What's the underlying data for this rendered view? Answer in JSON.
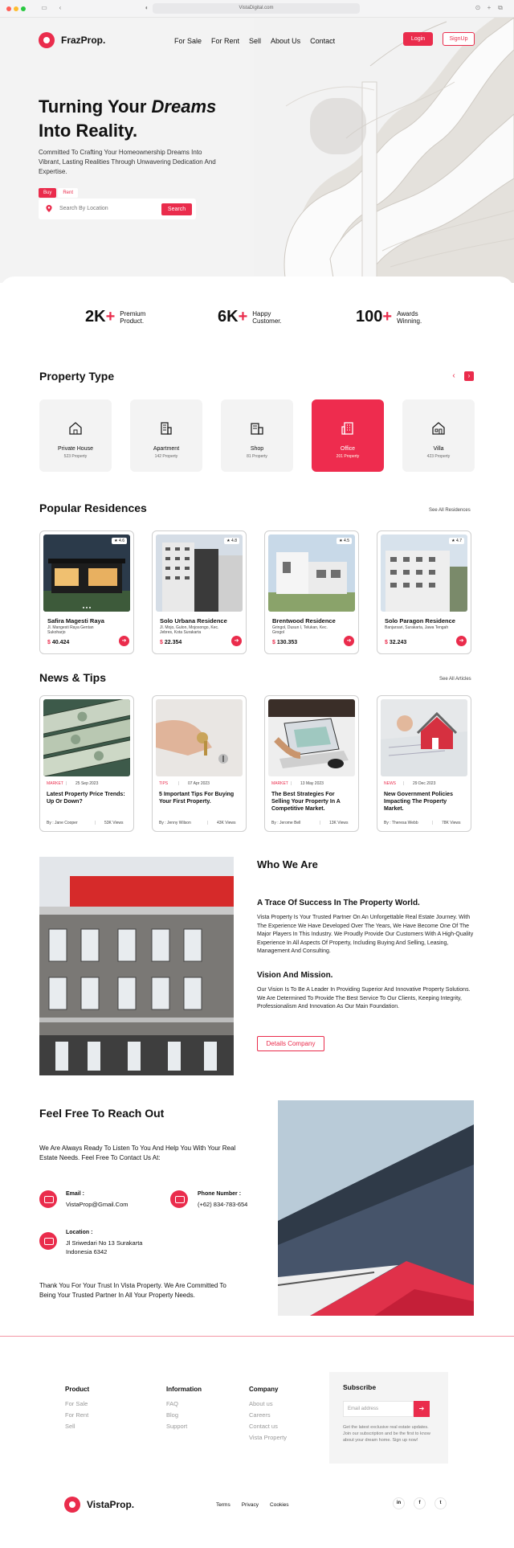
{
  "browser": {
    "url": "VistaDigital.com"
  },
  "header": {
    "brand": "FrazProp.",
    "nav": [
      "For Sale",
      "For Rent",
      "Sell",
      "About Us",
      "Contact"
    ],
    "login": "Login",
    "signup": "SignUp"
  },
  "hero": {
    "title_line1_a": "Turning Your ",
    "title_line1_b": "Dreams",
    "title_line2": "Into Reality.",
    "subtitle": "Committed To Crafting Your Homeownership Dreams Into Vibrant, Lasting Realities Through Unwavering Dedication And Expertise.",
    "tab_buy": "Buy",
    "tab_rent": "Rent",
    "search_placeholder": "Search By Location",
    "search_button": "Search"
  },
  "stats": [
    {
      "num": "2K",
      "plus": "+",
      "label": "Premium Product."
    },
    {
      "num": "6K",
      "plus": "+",
      "label": "Happy Customer."
    },
    {
      "num": "100",
      "plus": "+",
      "label": "Awards Winning."
    }
  ],
  "property_type": {
    "title": "Property Type",
    "items": [
      {
        "name": "Private House",
        "count": "523 Property",
        "icon": "house-icon"
      },
      {
        "name": "Apartment",
        "count": "142 Property",
        "icon": "apartment-icon"
      },
      {
        "name": "Shop",
        "count": "81 Property",
        "icon": "shop-icon"
      },
      {
        "name": "Office",
        "count": "201 Property",
        "icon": "office-icon"
      },
      {
        "name": "Villa",
        "count": "423 Property",
        "icon": "villa-icon"
      }
    ]
  },
  "popular": {
    "title": "Popular Residences",
    "see_all": "See All Residences",
    "items": [
      {
        "name": "Safira Magesti Raya",
        "address": "Jl. Mangesti Raya Gentan Sukoharjo",
        "price_symbol": "$",
        "price": "40.424",
        "rating": "★ 4.6"
      },
      {
        "name": "Solo Urbana Residence",
        "address": "Jl. Mojo, Gulon, Mojosongo, Kec. Jebres, Kota Surakarta",
        "price_symbol": "$",
        "price": "22.354",
        "rating": "★ 4.8"
      },
      {
        "name": "Brentwood Residence",
        "address": "Gringol, Dusun I, Telukan, Kec. Grogol",
        "price_symbol": "$",
        "price": "130.353",
        "rating": "★ 4.5"
      },
      {
        "name": "Solo Paragon Residence",
        "address": "Banjarsari, Surakarta, Jawa Tengah",
        "price_symbol": "$",
        "price": "32.243",
        "rating": "★ 4.7"
      }
    ]
  },
  "news": {
    "title": "News & Tips",
    "see_all": "See All Articles",
    "items": [
      {
        "category": "MARKET",
        "date": "25 Sep 2023",
        "title": "Latest Property Price Trends: Up Or Down?",
        "author": "By : Jane Cooper",
        "views": "53K Views"
      },
      {
        "category": "TIPS",
        "date": "07 Apr 2023",
        "title": "5 Important Tips For Buying Your First Property.",
        "author": "By : Jenny Wilson",
        "views": "43K Views"
      },
      {
        "category": "MARKET",
        "date": "13 May 2023",
        "title": "The Best Strategies For Selling Your Property In A Competitive Market.",
        "author": "By : Jerome Bell",
        "views": "13K Views"
      },
      {
        "category": "NEWS",
        "date": "29 Dec 2023",
        "title": "New Government Policies Impacting The Property Market.",
        "author": "By : Theresa Webb",
        "views": "78K Views"
      }
    ]
  },
  "about": {
    "title": "Who We Are",
    "subtitle1": "A Trace Of Success In The Property World.",
    "para1": "Vista Property Is Your Trusted Partner On An Unforgettable Real Estate Journey. With The Experience We Have Developed Over The Years, We Have Become One Of The Major Players In This Industry. We Proudly Provide Our Customers With A High-Quality Experience In All Aspects Of Property, Including Buying And Selling, Leasing, Management And Consulting.",
    "subtitle2": "Vision And Mission.",
    "para2": "Our Vision Is To Be A Leader In Providing Superior And Innovative Property Solutions. We Are Determined To Provide The Best Service To Our Clients, Keeping Integrity, Professionalism And Innovation As Our Main Foundation.",
    "button": "Details Company"
  },
  "contact": {
    "title": "Feel Free To Reach Out",
    "intro": "We Are Always Ready To Listen To You And Help You With Your Real Estate Needs. Feel Free To Contact Us At:",
    "email_label": "Email :",
    "email": "VistaProp@Gmail.Com",
    "phone_label": "Phone Number :",
    "phone": "(+62) 834-783-654",
    "location_label": "Location :",
    "location_line1": "Jl Sriwedari No 13 Surakarta",
    "location_line2": "Indonesia 6342",
    "outro": "Thank You For Your Trust In Vista Property. We Are Committed To Being Your Trusted Partner In All Your Property Needs."
  },
  "footer": {
    "product": {
      "title": "Product",
      "links": [
        "For Sale",
        "For Rent",
        "Sell"
      ]
    },
    "information": {
      "title": "Information",
      "links": [
        "FAQ",
        "Blog",
        "Support"
      ]
    },
    "company": {
      "title": "Company",
      "links": [
        "About us",
        "Careers",
        "Contact us",
        "Vista Property"
      ]
    },
    "subscribe": {
      "title": "Subscribe",
      "placeholder": "Email address",
      "note": "Get the latest exclusive real estate updates. Join our subscription and be the first to know about your dream home. Sign up now!"
    },
    "brand": "VistaProp.",
    "legal": [
      "Terms",
      "Privacy",
      "Cookies"
    ],
    "social": [
      "in",
      "f",
      "t"
    ]
  },
  "colors": {
    "accent": "#ea2c4c"
  }
}
